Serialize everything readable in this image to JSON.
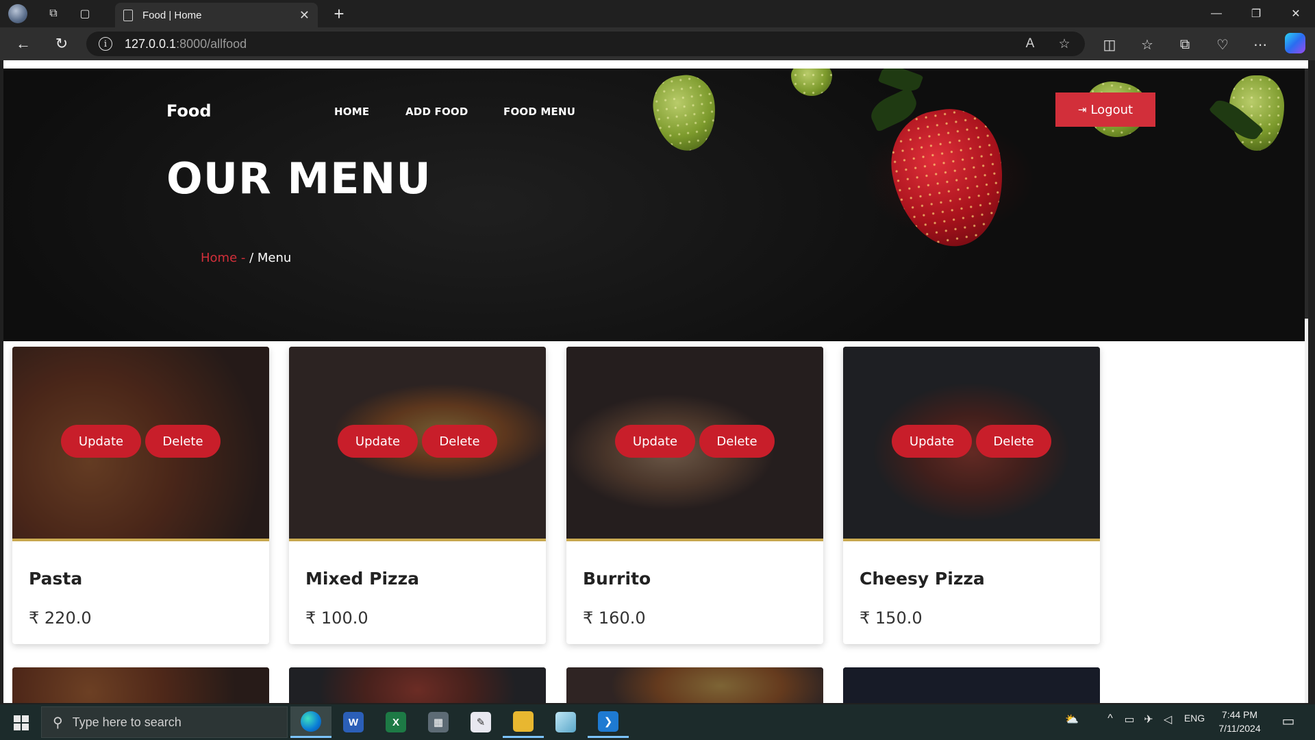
{
  "browser": {
    "tab_title": "Food | Home",
    "close_tab": "✕",
    "new_tab": "+",
    "url_host": "127.0.0.1",
    "url_path": ":8000/allfood",
    "window": {
      "minimize": "—",
      "maximize": "❐",
      "close": "✕"
    }
  },
  "site": {
    "brand": "Food",
    "nav": [
      "HOME",
      "ADD FOOD",
      "FOOD MENU"
    ],
    "logout_label": "Logout",
    "hero_title": "OUR MENU",
    "breadcrumb": {
      "home": "Home",
      "sep": " - ",
      "current": "/ Menu"
    }
  },
  "menu": {
    "update_label": "Update",
    "delete_label": "Delete",
    "items": [
      {
        "name": "Pasta",
        "price": "₹ 220.0"
      },
      {
        "name": "Mixed Pizza",
        "price": "₹ 100.0"
      },
      {
        "name": "Burrito",
        "price": "₹ 160.0"
      },
      {
        "name": "Cheesy Pizza",
        "price": "₹ 150.0"
      }
    ]
  },
  "taskbar": {
    "search_placeholder": "Type here to search",
    "language": "ENG",
    "time": "7:44 PM",
    "date": "7/11/2024",
    "apps": [
      "edge-icon",
      "word-icon",
      "excel-icon",
      "calculator-icon",
      "feedback-icon",
      "file-explorer-icon",
      "paint-icon",
      "vscode-icon"
    ]
  },
  "colors": {
    "accent_red": "#d22f3a",
    "button_red": "#c81e2a",
    "gold_line": "#c9a94f"
  }
}
